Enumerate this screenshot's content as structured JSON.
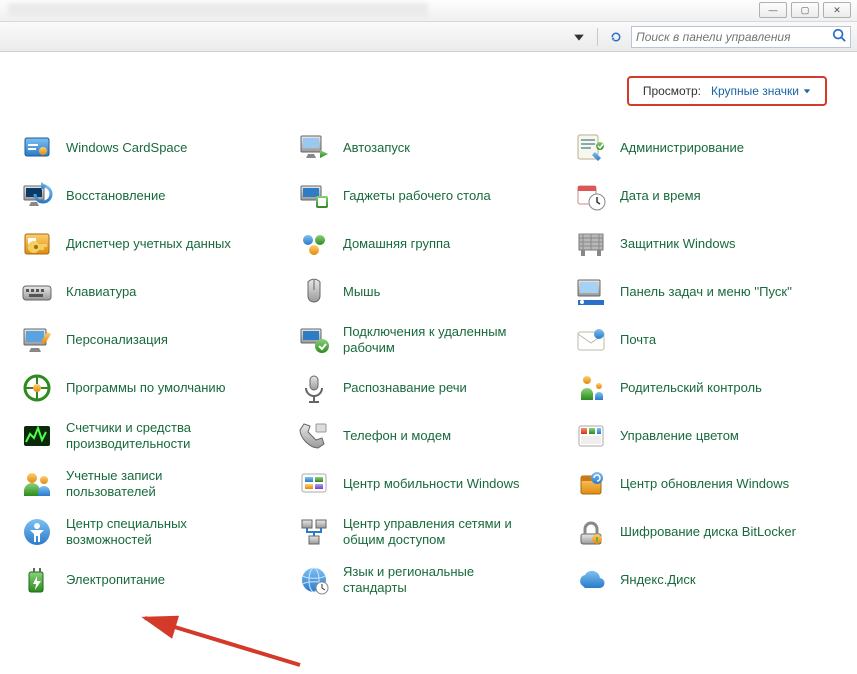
{
  "window": {
    "minimize_glyph": "—",
    "maximize_glyph": "▢",
    "close_glyph": "✕"
  },
  "toolbar": {
    "search_placeholder": "Поиск в панели управления"
  },
  "view": {
    "label": "Просмотр:",
    "mode": "Крупные значки"
  },
  "items": [
    {
      "id": "cardspace",
      "label": "Windows CardSpace",
      "icon": "cardspace"
    },
    {
      "id": "autoplay",
      "label": "Автозапуск",
      "icon": "autoplay"
    },
    {
      "id": "admintools",
      "label": "Администрирование",
      "icon": "admintools"
    },
    {
      "id": "recovery",
      "label": "Восстановление",
      "icon": "recovery"
    },
    {
      "id": "gadgets",
      "label": "Гаджеты рабочего стола",
      "icon": "gadgets"
    },
    {
      "id": "datetime",
      "label": "Дата и время",
      "icon": "datetime"
    },
    {
      "id": "credmgr",
      "label": "Диспетчер учетных данных",
      "icon": "credmgr"
    },
    {
      "id": "homegroup",
      "label": "Домашняя группа",
      "icon": "homegroup"
    },
    {
      "id": "defender",
      "label": "Защитник Windows",
      "icon": "defender"
    },
    {
      "id": "keyboard",
      "label": "Клавиатура",
      "icon": "keyboard"
    },
    {
      "id": "mouse",
      "label": "Мышь",
      "icon": "mouse"
    },
    {
      "id": "taskbar",
      "label": "Панель задач и меню ''Пуск''",
      "icon": "taskbar"
    },
    {
      "id": "personalize",
      "label": "Персонализация",
      "icon": "personalize"
    },
    {
      "id": "remote",
      "label": "Подключения к удаленным рабочим",
      "icon": "remote"
    },
    {
      "id": "mail",
      "label": "Почта",
      "icon": "mail"
    },
    {
      "id": "defaultprog",
      "label": "Программы по умолчанию",
      "icon": "defaultprog"
    },
    {
      "id": "speech",
      "label": "Распознавание речи",
      "icon": "speech"
    },
    {
      "id": "parental",
      "label": "Родительский контроль",
      "icon": "parental"
    },
    {
      "id": "perf",
      "label": "Счетчики и средства производительности",
      "icon": "perf"
    },
    {
      "id": "phone",
      "label": "Телефон и модем",
      "icon": "phone"
    },
    {
      "id": "color",
      "label": "Управление цветом",
      "icon": "color"
    },
    {
      "id": "users",
      "label": "Учетные записи пользователей",
      "icon": "users"
    },
    {
      "id": "mobility",
      "label": "Центр мобильности Windows",
      "icon": "mobility"
    },
    {
      "id": "update",
      "label": "Центр обновления Windows",
      "icon": "update"
    },
    {
      "id": "ease",
      "label": "Центр специальных возможностей",
      "icon": "ease"
    },
    {
      "id": "network",
      "label": "Центр управления сетями и общим доступом",
      "icon": "network"
    },
    {
      "id": "bitlocker",
      "label": "Шифрование диска BitLocker",
      "icon": "bitlocker"
    },
    {
      "id": "power",
      "label": "Электропитание",
      "icon": "power"
    },
    {
      "id": "region",
      "label": "Язык и региональные стандарты",
      "icon": "region"
    },
    {
      "id": "yadisk",
      "label": "Яндекс.Диск",
      "icon": "yadisk"
    }
  ]
}
